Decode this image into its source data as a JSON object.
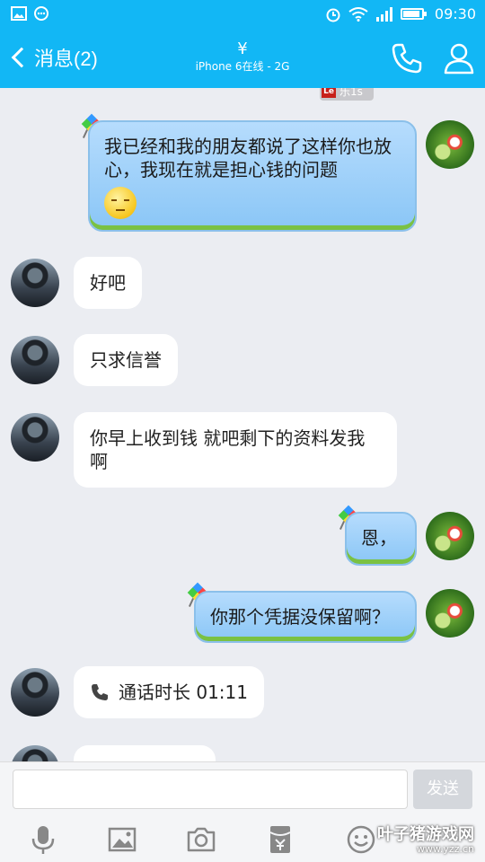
{
  "status": {
    "time": "09:30"
  },
  "header": {
    "back_label": "消息(2)",
    "contact_name": "¥",
    "contact_status": "iPhone 6在线 - 2G"
  },
  "tag": {
    "badge": "Le",
    "label": "乐1s"
  },
  "messages": [
    {
      "side": "right",
      "text": "我已经和我的朋友都说了这样你也放心，我现在就是担心钱的问题",
      "emoji": "smug-face"
    },
    {
      "side": "left",
      "text": "好吧"
    },
    {
      "side": "left",
      "text": "只求信誉"
    },
    {
      "side": "left",
      "text": "你早上收到钱 就吧剩下的资料发我啊"
    },
    {
      "side": "right",
      "text": "恩，"
    },
    {
      "side": "right",
      "text": "你那个凭据没保留啊？"
    },
    {
      "side": "left",
      "text": "通话时长 01:11",
      "icon": "phone-icon"
    }
  ],
  "input": {
    "placeholder": "",
    "send_label": "发送"
  },
  "watermark": {
    "text": "叶子猪游戏网",
    "url": "www.yzz.cn"
  },
  "colors": {
    "accent": "#12b7f5",
    "bubble_right": "#8ac6f6",
    "background": "#ebedf2"
  }
}
